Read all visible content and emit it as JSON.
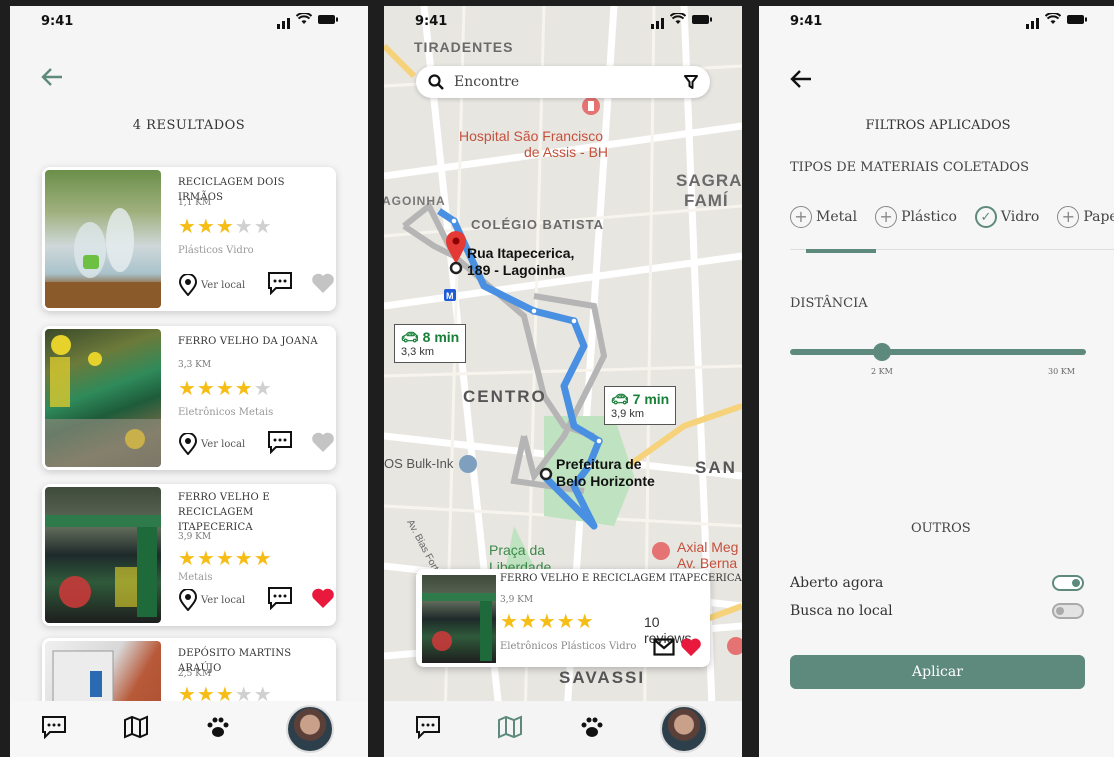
{
  "status": {
    "time": "9:41"
  },
  "results": {
    "title": "4 RESULTADOS",
    "ver_local": "Ver local",
    "cards": [
      {
        "name": "RECICLAGEM DOIS IRMÃOS",
        "distance": "1,1 KM",
        "rating": 3,
        "materials": "Plásticos  Vidro",
        "favorite": false
      },
      {
        "name": "FERRO VELHO DA JOANA",
        "distance": "3,3 KM",
        "rating": 4,
        "materials": "Eletrônicos  Metais",
        "favorite": false
      },
      {
        "name": "FERRO VELHO E RECICLAGEM ITAPECERICA",
        "distance": "3,9 KM",
        "rating": 5,
        "materials": "Metais",
        "favorite": true
      },
      {
        "name": "DEPÓSITO MARTINS ARAÚJO",
        "distance": "2,5 KM",
        "rating": 3,
        "materials": "",
        "favorite": false
      }
    ]
  },
  "map": {
    "search_placeholder": "Encontre",
    "labels": {
      "tiradentes": "TIRADENTES",
      "hospital": "Hospital São Francisco",
      "hospital2": "de Assis - BH",
      "sagra": "SAGRA",
      "sagra2": "FAMÍ",
      "agoinha": "AGOINHA",
      "colegio": "COLÉGIO BATISTA",
      "rua": "Rua Itapecerica,",
      "rua2": "189 - Lagoinha",
      "centro": "CENTRO",
      "prefeitura": "Prefeitura de",
      "prefeitura2": "Belo Horizonte",
      "san": "SAN",
      "bulkink": "OS Bulk-Ink",
      "praca": "Praça da",
      "praca2": "Liberdade",
      "axial": "Axial Meg",
      "axial2": "Av. Berna",
      "savassi": "SAVASSI",
      "bias": "Av. Bias Fortes"
    },
    "route_a": {
      "time": "8 min",
      "dist": "3,3 km"
    },
    "route_b": {
      "time": "7 min",
      "dist": "3,9 km"
    },
    "card": {
      "name": "FERRO VELHO E RECICLAGEM ITAPECERICA",
      "distance": "3,9 KM",
      "rating": 5,
      "reviews": "10 reviews",
      "materials": "Eletrônicos   Plásticos   Vidro"
    }
  },
  "filters": {
    "title": "FILTROS APLICADOS",
    "materials_label": "TIPOS DE MATERIAIS COLETADOS",
    "chips": [
      {
        "label": "Metal",
        "selected": false
      },
      {
        "label": "Plástico",
        "selected": false
      },
      {
        "label": "Vidro",
        "selected": true
      },
      {
        "label": "Papel",
        "selected": false
      }
    ],
    "distance_label": "DISTÂNCIA",
    "distance_value_km": 2,
    "distance_min": "2 KM",
    "distance_max": "30 KM",
    "others_label": "OUTROS",
    "open_now": {
      "label": "Aberto agora",
      "on": true
    },
    "local_search": {
      "label": "Busca no local",
      "on": false
    },
    "apply_label": "Aplicar"
  },
  "colors": {
    "accent": "#5e8a7d",
    "star": "#f5bd15",
    "heart": "#e8193c",
    "route": "#4a90e2"
  }
}
